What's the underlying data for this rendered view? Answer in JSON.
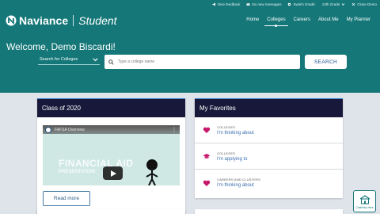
{
  "util": [
    {
      "label": "Give feedback",
      "icon": "megaphone-icon"
    },
    {
      "label": "No new messages",
      "icon": "envelope-icon"
    },
    {
      "label": "Switch Grade:",
      "icon": "gear-icon"
    },
    {
      "label": "12th Grade",
      "icon": "chevron-down-icon"
    },
    {
      "label": "Close Demo",
      "icon": "close-icon"
    }
  ],
  "brand": {
    "name": "Naviance",
    "sub": "Student"
  },
  "nav": [
    "Home",
    "Colleges",
    "Careers",
    "About Me",
    "My Planner"
  ],
  "nav_active": "Colleges",
  "welcome": "Welcome, Demo Biscardi!",
  "search": {
    "select_label": "Search for Colleges",
    "placeholder": "Type a college name",
    "button": "SEARCH"
  },
  "card_a": {
    "title": "Class of 2020",
    "video_title": "FAFSA Overview",
    "video_big": "FINANCIAL AID",
    "video_small": "PRESENTATION",
    "read_more": "Read more"
  },
  "card_b": {
    "title": "My Favorites",
    "items": [
      {
        "category": "COLLEGES",
        "label": "I'm thinking about",
        "icon": "heart-icon"
      },
      {
        "category": "COLLEGES",
        "label": "I'm applying to",
        "icon": "graduation-cap-icon"
      },
      {
        "category": "CAREERS AND CLUSTERS",
        "label": "I'm thinking about",
        "icon": "heart-icon"
      }
    ]
  },
  "chip": "Chat/Help Here",
  "colors": {
    "teal": "#157778",
    "navy": "#17183a",
    "heart": "#c8176b",
    "link": "#3d6fb0",
    "bg": "#dfe3ea"
  }
}
